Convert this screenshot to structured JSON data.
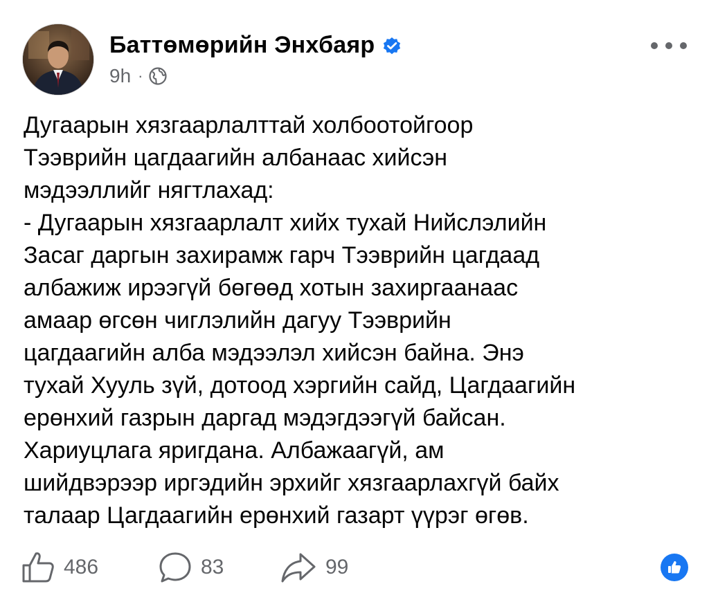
{
  "author": {
    "name": "Баттөмөрийн Энхбаяр",
    "verified": true
  },
  "meta": {
    "time": "9h",
    "separator": "·",
    "audience_icon": "globe-icon"
  },
  "post": {
    "lines": [
      "Дугаарын хязгаарлалттай холбоотойгоор",
      "Тээврийн цагдаагийн албанаас хийсэн",
      "мэдээллийг нягтлахад:",
      "- Дугаарын хязгаарлалт хийх тухай Нийслэлийн",
      "Засаг даргын захирамж гарч Тээврийн цагдаад",
      "албажиж ирээгүй бөгөөд хотын захиргаанаас",
      "амаар өгсөн чиглэлийн дагуу Тээврийн",
      "цагдаагийн алба мэдээлэл хийсэн байна. Энэ",
      "тухай Хууль зүй, дотоод хэргийн сайд, Цагдаагийн",
      "ерөнхий газрын даргад мэдэгдээгүй байсан.",
      "Хариуцлага яригдана. Албажаагүй, ам",
      "шийдвэрээр иргэдийн эрхийг хязгаарлахгүй байх",
      "талаар Цагдаагийн ерөнхий газарт үүрэг өгөв."
    ]
  },
  "footer": {
    "likes": "486",
    "comments": "83",
    "shares": "99"
  },
  "colors": {
    "text": "#050505",
    "secondary": "#65676b",
    "accent": "#1877f2"
  }
}
